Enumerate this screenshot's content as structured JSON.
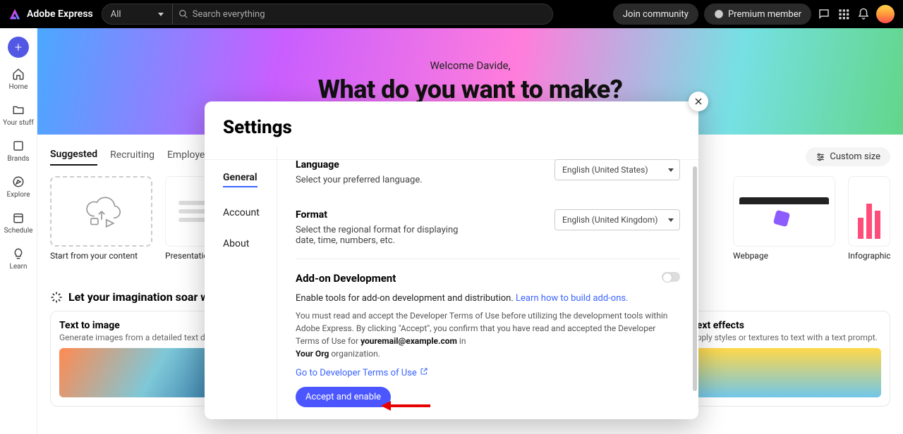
{
  "topbar": {
    "brand": "Adobe Express",
    "filter_label": "All",
    "search_placeholder": "Search everything",
    "join_label": "Join community",
    "premium_label": "Premium member"
  },
  "leftrail": {
    "items": [
      {
        "label": "Home"
      },
      {
        "label": "Your stuff"
      },
      {
        "label": "Brands"
      },
      {
        "label": "Explore"
      },
      {
        "label": "Schedule"
      },
      {
        "label": "Learn"
      }
    ]
  },
  "hero": {
    "welcome": "Welcome Davide,",
    "title": "What do you want to make?"
  },
  "tabs": {
    "items": [
      "Suggested",
      "Recruiting",
      "Employee engagement"
    ],
    "custom_size": "Custom size"
  },
  "templates": {
    "items": [
      {
        "label": "Start from your content"
      },
      {
        "label": "Presentation"
      },
      {
        "label": "Webpage"
      },
      {
        "label": "Infographic"
      }
    ]
  },
  "genai": {
    "heading": "Let your imagination soar with generative AI",
    "cards": [
      {
        "title": "Text to image",
        "sub": "Generate images from a detailed text description."
      },
      {
        "title": "Text effects",
        "sub": "Apply styles or textures to text with a text prompt."
      }
    ]
  },
  "modal": {
    "title": "Settings",
    "nav": {
      "general": "General",
      "account": "Account",
      "about": "About"
    },
    "language": {
      "heading": "Language",
      "desc": "Select your preferred language.",
      "value": "English (United States)"
    },
    "format": {
      "heading": "Format",
      "desc": "Select the regional format for displaying date, time, numbers, etc.",
      "value": "English (United Kingdom)"
    },
    "addon": {
      "heading": "Add-on Development",
      "line1a": "Enable tools for add-on development and distribution. ",
      "line1_link": "Learn how to build add-ons.",
      "terms_a": "You must read and accept the Developer Terms of Use before utilizing the development tools within Adobe Express. By clicking \"Accept\", you confirm that you have read and accepted the Developer Terms of Use for ",
      "email": "youremail@example.com",
      "in": " in",
      "org": "Your Org",
      "org_suffix": " organization.",
      "goto": "Go to Developer Terms of Use",
      "accept": "Accept and enable"
    }
  }
}
